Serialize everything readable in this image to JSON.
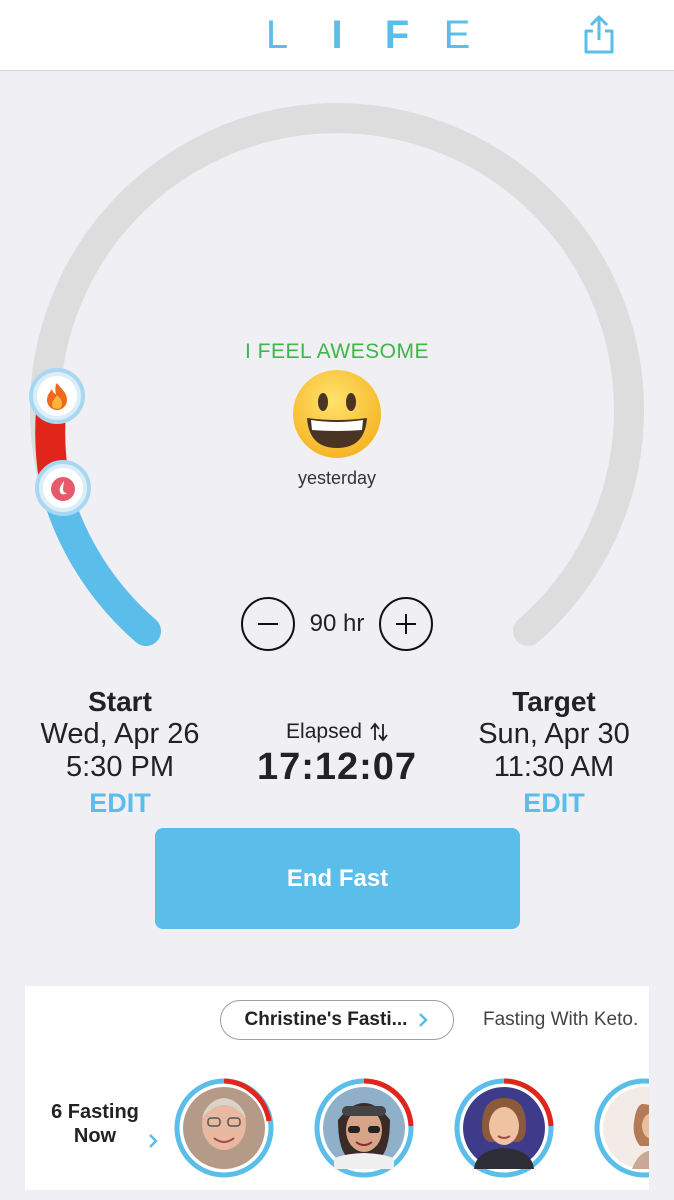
{
  "header": {
    "logo_letters": [
      "L",
      "I",
      "F",
      "E"
    ],
    "share_icon": "share-icon"
  },
  "mood": {
    "title": "I FEEL AWESOME",
    "emoji_icon": "grinning-face-icon",
    "when": "yesterday"
  },
  "dial": {
    "progress_fraction": 0.19,
    "stage_icons": [
      "flame-icon",
      "droplet-icon"
    ],
    "colors": {
      "track": "#dddddd",
      "elapsed": "#5bbde9",
      "stage": "#e1251b"
    }
  },
  "duration": {
    "value": "90 hr",
    "minus_icon": "minus-icon",
    "plus_icon": "plus-icon"
  },
  "start": {
    "label": "Start",
    "date": "Wed, Apr 26",
    "time": "5:30 PM",
    "edit": "EDIT"
  },
  "elapsed": {
    "label": "Elapsed",
    "time": "17:12:07",
    "swap_icon": "swap-icon"
  },
  "target": {
    "label": "Target",
    "date": "Sun, Apr 30",
    "time": "11:30 AM",
    "edit": "EDIT"
  },
  "end_button": "End Fast",
  "community": {
    "active_circle": "Christine's Fasti...",
    "other_circle": "Fasting With Keto.",
    "fasting_now": {
      "line1": "6 Fasting",
      "line2": "Now"
    },
    "avatars": [
      "avatar-1",
      "avatar-2",
      "avatar-3",
      "avatar-4"
    ]
  },
  "accent_color": "#5bbde9"
}
